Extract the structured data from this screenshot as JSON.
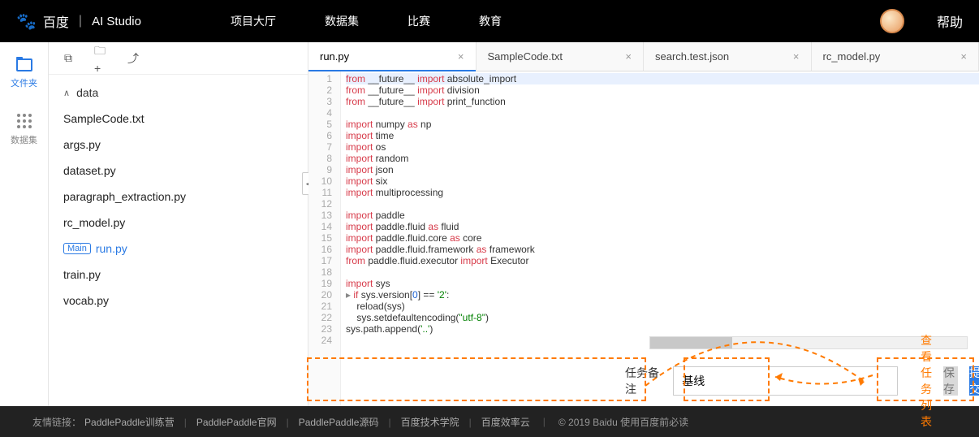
{
  "header": {
    "baidu": "百度",
    "studio": "AI Studio",
    "nav": [
      "项目大厅",
      "数据集",
      "比赛",
      "教育"
    ],
    "help": "帮助"
  },
  "rail": {
    "files": "文件夹",
    "data": "数据集"
  },
  "toolbar": {
    "new": "[+]",
    "newfolder": "□+",
    "upload": "↥"
  },
  "tree": {
    "folder": "data",
    "files": [
      "SampleCode.txt",
      "args.py",
      "dataset.py",
      "paragraph_extraction.py",
      "rc_model.py",
      "run.py",
      "train.py",
      "vocab.py"
    ],
    "main_badge": "Main",
    "active_index": 5
  },
  "tabs": [
    {
      "label": "run.py",
      "active": true
    },
    {
      "label": "SampleCode.txt",
      "active": false
    },
    {
      "label": "search.test.json",
      "active": false
    },
    {
      "label": "rc_model.py",
      "active": false
    }
  ],
  "code": {
    "lines": [
      {
        "n": 1,
        "tok": [
          [
            "kw",
            "from"
          ],
          [
            "mod",
            " __future__ "
          ],
          [
            "kw",
            "import"
          ],
          [
            "mod",
            " absolute_import"
          ]
        ],
        "hl": true
      },
      {
        "n": 2,
        "tok": [
          [
            "kw",
            "from"
          ],
          [
            "mod",
            " __future__ "
          ],
          [
            "kw",
            "import"
          ],
          [
            "mod",
            " division"
          ]
        ]
      },
      {
        "n": 3,
        "tok": [
          [
            "kw",
            "from"
          ],
          [
            "mod",
            " __future__ "
          ],
          [
            "kw",
            "import"
          ],
          [
            "mod",
            " print_function"
          ]
        ]
      },
      {
        "n": 4,
        "tok": []
      },
      {
        "n": 5,
        "tok": [
          [
            "kw",
            "import"
          ],
          [
            "mod",
            " numpy "
          ],
          [
            "kw",
            "as"
          ],
          [
            "mod",
            " np"
          ]
        ]
      },
      {
        "n": 6,
        "tok": [
          [
            "kw",
            "import"
          ],
          [
            "mod",
            " time"
          ]
        ]
      },
      {
        "n": 7,
        "tok": [
          [
            "kw",
            "import"
          ],
          [
            "mod",
            " os"
          ]
        ]
      },
      {
        "n": 8,
        "tok": [
          [
            "kw",
            "import"
          ],
          [
            "mod",
            " random"
          ]
        ]
      },
      {
        "n": 9,
        "tok": [
          [
            "kw",
            "import"
          ],
          [
            "mod",
            " json"
          ]
        ]
      },
      {
        "n": 10,
        "tok": [
          [
            "kw",
            "import"
          ],
          [
            "mod",
            " six"
          ]
        ]
      },
      {
        "n": 11,
        "tok": [
          [
            "kw",
            "import"
          ],
          [
            "mod",
            " multiprocessing"
          ]
        ]
      },
      {
        "n": 12,
        "tok": []
      },
      {
        "n": 13,
        "tok": [
          [
            "kw",
            "import"
          ],
          [
            "mod",
            " paddle"
          ]
        ]
      },
      {
        "n": 14,
        "tok": [
          [
            "kw",
            "import"
          ],
          [
            "mod",
            " paddle.fluid "
          ],
          [
            "kw",
            "as"
          ],
          [
            "mod",
            " fluid"
          ]
        ]
      },
      {
        "n": 15,
        "tok": [
          [
            "kw",
            "import"
          ],
          [
            "mod",
            " paddle.fluid.core "
          ],
          [
            "kw",
            "as"
          ],
          [
            "mod",
            " core"
          ]
        ]
      },
      {
        "n": 16,
        "tok": [
          [
            "kw",
            "import"
          ],
          [
            "mod",
            " paddle.fluid.framework "
          ],
          [
            "kw",
            "as"
          ],
          [
            "mod",
            " framework"
          ]
        ]
      },
      {
        "n": 17,
        "tok": [
          [
            "kw",
            "from"
          ],
          [
            "mod",
            " paddle.fluid.executor "
          ],
          [
            "kw",
            "import"
          ],
          [
            "mod",
            " Executor"
          ]
        ]
      },
      {
        "n": 18,
        "tok": []
      },
      {
        "n": 19,
        "tok": [
          [
            "kw",
            "import"
          ],
          [
            "mod",
            " sys"
          ]
        ]
      },
      {
        "n": 20,
        "tok": [
          [
            "kw",
            "if"
          ],
          [
            "mod",
            " sys.version["
          ],
          [
            "num",
            "0"
          ],
          [
            "mod",
            "] == "
          ],
          [
            "str",
            "'2'"
          ],
          [
            "mod",
            ":"
          ]
        ],
        "expand": true
      },
      {
        "n": 21,
        "tok": [
          [
            "mod",
            "    reload(sys)"
          ]
        ]
      },
      {
        "n": 22,
        "tok": [
          [
            "mod",
            "    sys.setdefaultencoding("
          ],
          [
            "str",
            "\"utf-8\""
          ],
          [
            "mod",
            ")"
          ]
        ]
      },
      {
        "n": 23,
        "tok": [
          [
            "mod",
            "sys.path.append("
          ],
          [
            "str",
            "'..'"
          ],
          [
            "mod",
            ")"
          ]
        ]
      },
      {
        "n": 24,
        "tok": []
      }
    ]
  },
  "bottom": {
    "task_label": "任务备注",
    "task_value": "基线",
    "view_tasks": "查看任务列表",
    "save": "保存",
    "submit": "提 交"
  },
  "footer": {
    "label": "友情链接：",
    "links": [
      "PaddlePaddle训练营",
      "PaddlePaddle官网",
      "PaddlePaddle源码",
      "百度技术学院",
      "百度效率云"
    ],
    "copyright": "© 2019 Baidu 使用百度前必读"
  }
}
